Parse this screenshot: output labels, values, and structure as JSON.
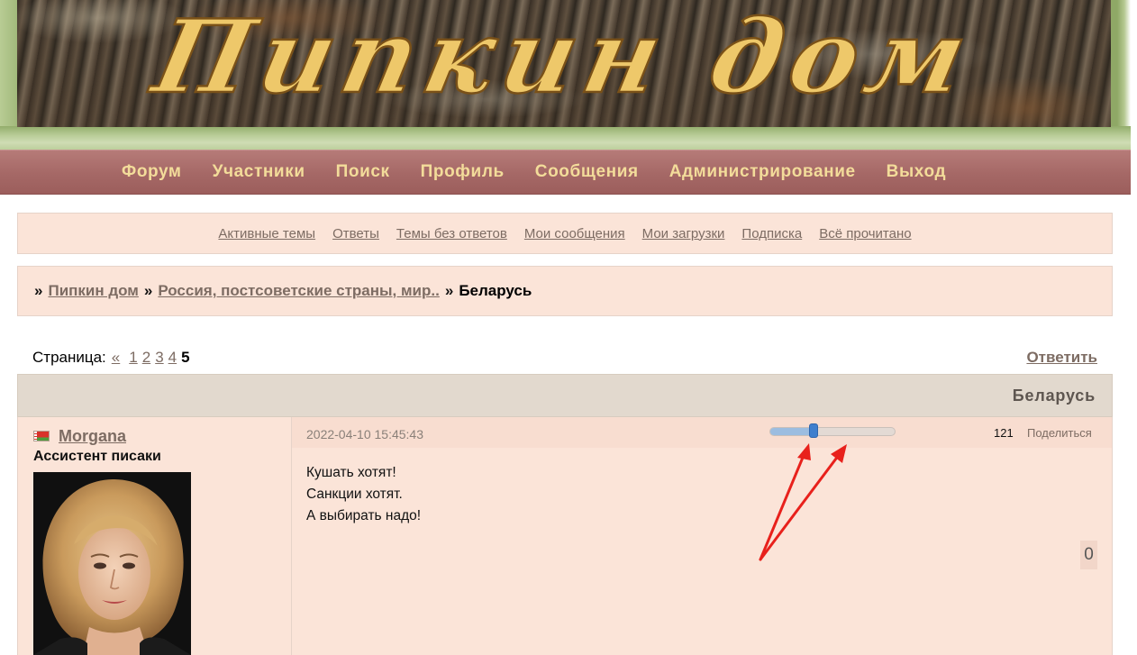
{
  "header": {
    "site_title": "Пипкин дом"
  },
  "nav": {
    "items": [
      "Форум",
      "Участники",
      "Поиск",
      "Профиль",
      "Сообщения",
      "Администрирование",
      "Выход"
    ]
  },
  "quicklinks": {
    "items": [
      "Активные темы",
      "Ответы",
      "Темы без ответов",
      "Мои сообщения",
      "Мои загрузки",
      "Подписка",
      "Всё прочитано"
    ]
  },
  "breadcrumb": {
    "separator": "»",
    "items": [
      "Пипкин дом",
      "Россия, постсоветские страны, мир.."
    ],
    "current": "Беларусь"
  },
  "pagination": {
    "label": "Страница:",
    "prev": "«",
    "pages": [
      "1",
      "2",
      "3",
      "4"
    ],
    "current": "5"
  },
  "reply_label": "Ответить",
  "topic": {
    "title": "Беларусь"
  },
  "post": {
    "author": "Morgana",
    "author_title": "Ассистент писаки",
    "date": "2022-04-10 15:45:43",
    "slider_value": 0.35,
    "number": "121",
    "share_label": "Поделиться",
    "lines": [
      "Кушать хотят!",
      "Санкции хотят.",
      "А выбирать надо!"
    ],
    "vote_count": "0"
  },
  "colors": {
    "nav_text": "#f3dc9a",
    "nav_bg": "#a56866",
    "panel_bg": "#fbe4d8",
    "link": "#7d6c63",
    "annotation_arrow": "#e8211c",
    "slider_thumb": "#3f7fce"
  }
}
